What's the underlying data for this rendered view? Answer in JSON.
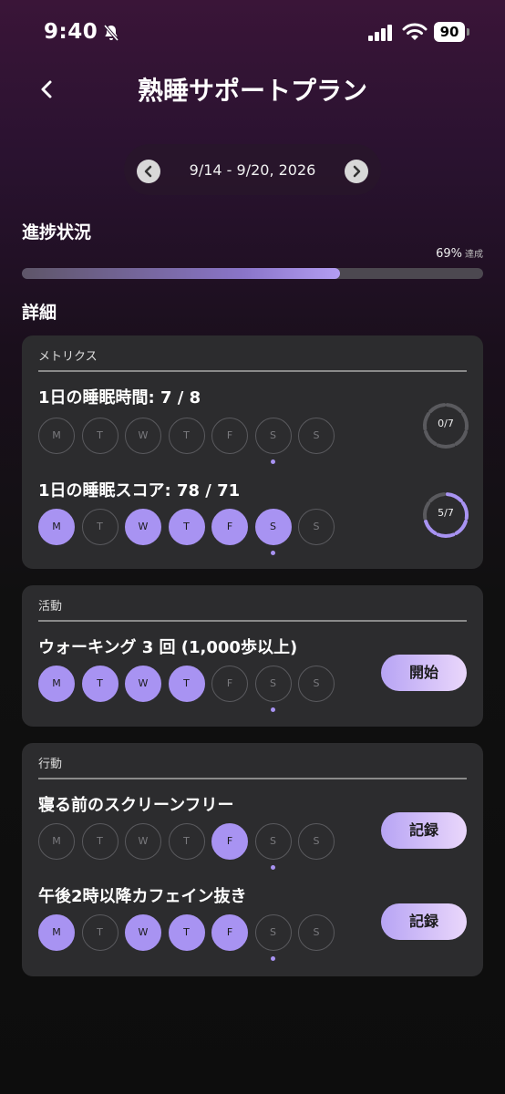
{
  "status_bar": {
    "time": "9:40",
    "battery": "90"
  },
  "header": {
    "title": "熟睡サポートプラン"
  },
  "week": {
    "label": "9/14 - 9/20, 2026"
  },
  "progress": {
    "heading": "進捗状況",
    "percent": "69%",
    "suffix": "達成",
    "fraction": 0.69
  },
  "details": {
    "heading": "詳細"
  },
  "day_labels": [
    "M",
    "T",
    "W",
    "T",
    "F",
    "S",
    "S"
  ],
  "cards": [
    {
      "label": "メトリクス",
      "items": [
        {
          "title": "1日の睡眠時間: 7 / 8",
          "filled": [
            false,
            false,
            false,
            false,
            false,
            false,
            false
          ],
          "ring": "0/7",
          "ring_fraction": 0
        },
        {
          "title": "1日の睡眠スコア: 78 / 71",
          "filled": [
            true,
            false,
            true,
            true,
            true,
            true,
            false
          ],
          "ring": "5/7",
          "ring_fraction": 0.714
        }
      ]
    },
    {
      "label": "活動",
      "items": [
        {
          "title": "ウォーキング 3 回 (1,000歩以上)",
          "filled": [
            true,
            true,
            true,
            true,
            false,
            false,
            false
          ],
          "button": "開始"
        }
      ]
    },
    {
      "label": "行動",
      "items": [
        {
          "title": "寝る前のスクリーンフリー",
          "filled": [
            false,
            false,
            false,
            false,
            true,
            false,
            false
          ],
          "button": "記録"
        },
        {
          "title": "午後2時以降カフェイン抜き",
          "filled": [
            true,
            false,
            true,
            true,
            true,
            false,
            false
          ],
          "button": "記録"
        }
      ]
    }
  ],
  "today_index": 5,
  "colors": {
    "accent": "#a893f2",
    "card": "#2c2c2e"
  }
}
